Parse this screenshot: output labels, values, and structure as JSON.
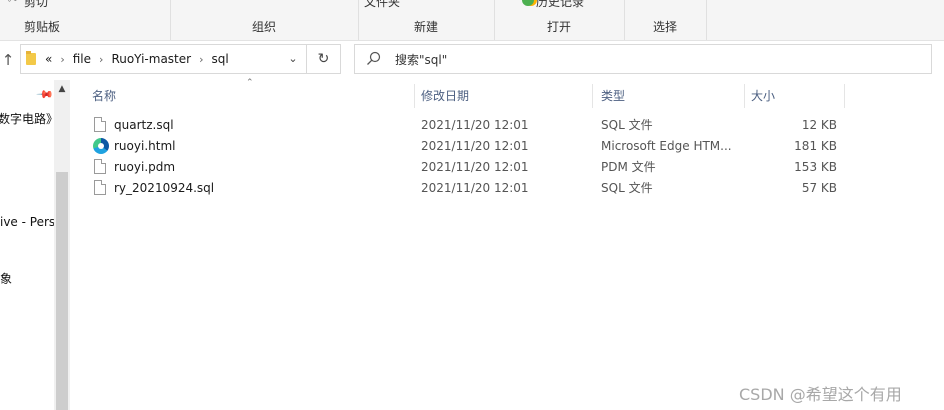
{
  "ribbon": {
    "clipboard": {
      "label": "剪贴板",
      "cut_label": "剪切"
    },
    "organize": {
      "label": "组织"
    },
    "new": {
      "label": "新建",
      "new_folder_label": "文件夹"
    },
    "open": {
      "label": "打开",
      "history_label": "历史记录"
    },
    "select": {
      "label": "选择"
    }
  },
  "address": {
    "overflow": "«",
    "crumbs": [
      "file",
      "RuoYi-master",
      "sql"
    ]
  },
  "search": {
    "placeholder": "搜索\"sql\""
  },
  "nav": {
    "items": [
      {
        "label": "数字电路》"
      },
      {
        "label": "ive - Perso"
      },
      {
        "label": "象"
      }
    ]
  },
  "columns": {
    "name": "名称",
    "date": "修改日期",
    "type": "类型",
    "size": "大小"
  },
  "files": [
    {
      "name": "quartz.sql",
      "date": "2021/11/20 12:01",
      "type": "SQL 文件",
      "size": "12 KB",
      "icon": "file-icon"
    },
    {
      "name": "ruoyi.html",
      "date": "2021/11/20 12:01",
      "type": "Microsoft Edge HTM...",
      "size": "181 KB",
      "icon": "edge-icon"
    },
    {
      "name": "ruoyi.pdm",
      "date": "2021/11/20 12:01",
      "type": "PDM 文件",
      "size": "153 KB",
      "icon": "file-icon"
    },
    {
      "name": "ry_20210924.sql",
      "date": "2021/11/20 12:01",
      "type": "SQL 文件",
      "size": "57 KB",
      "icon": "file-icon"
    }
  ],
  "watermark": "CSDN @希望这个有用"
}
